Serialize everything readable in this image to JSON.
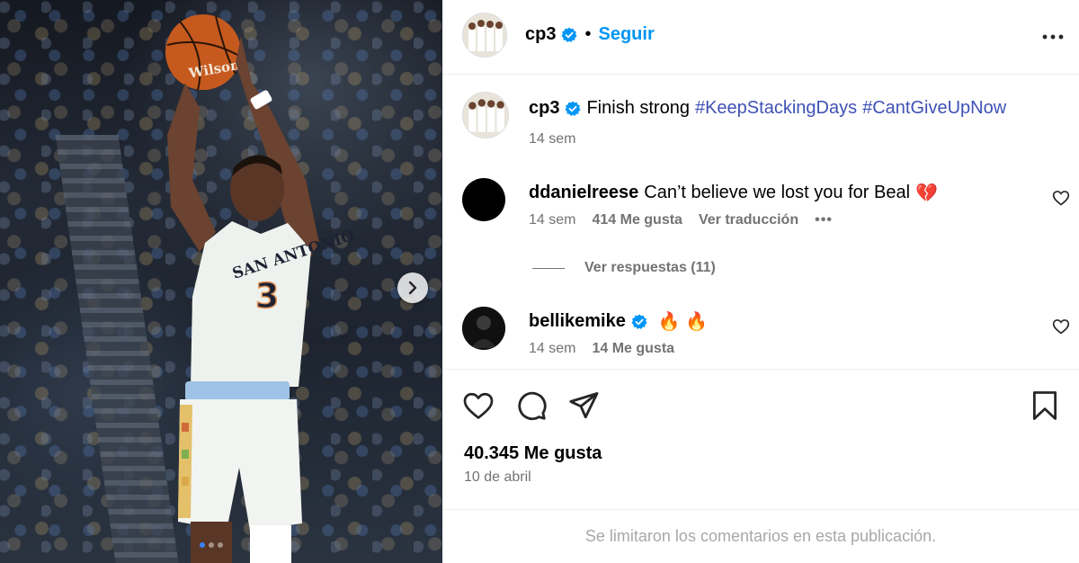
{
  "post": {
    "author": "cp3",
    "follow_label": "Seguir",
    "bullet": "•",
    "caption": {
      "username": "cp3",
      "text": "Finish strong",
      "hashtags": [
        "#KeepStackingDays",
        "#CantGiveUpNow"
      ],
      "time": "14 sem"
    },
    "jersey_text": "SAN ANTONIO",
    "jersey_number": "3",
    "ball_text": "Wilson"
  },
  "comments": [
    {
      "username": "ddanielreese",
      "text": "Can’t believe we lost you for Beal",
      "emoji": "💔",
      "time": "14 sem",
      "likes": "414 Me gusta",
      "translate": "Ver traducción",
      "more": "•••",
      "replies": "Ver respuestas (11)"
    },
    {
      "username": "bellikemike",
      "text": "",
      "emoji": "🔥 🔥",
      "time": "14 sem",
      "likes": "14 Me gusta"
    }
  ],
  "stats": {
    "likes": "40.345 Me gusta",
    "date": "10 de abril"
  },
  "footer": {
    "notice": "Se limitaron los comentarios en esta publicación."
  },
  "carousel": {
    "slide_count": 3,
    "active_index": 0
  },
  "colors": {
    "accent_blue": "#0095f6",
    "hashtag": "#3f51b5",
    "verified": "#0095f6",
    "muted": "#737373"
  },
  "icons": [
    "verified-icon",
    "more-icon",
    "heart-icon",
    "comment-icon",
    "share-icon",
    "bookmark-icon",
    "chevron-right-icon"
  ]
}
